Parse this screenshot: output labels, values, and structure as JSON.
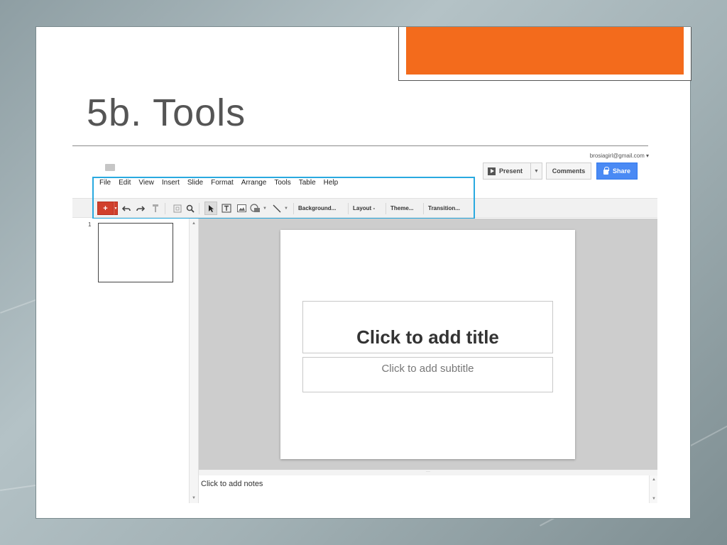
{
  "slide": {
    "title": "5b. Tools",
    "accent_color": "#f36b1c",
    "highlight_color": "#29a9e0"
  },
  "app": {
    "account": "brosiagirl@gmail.com ▾",
    "menu": [
      "File",
      "Edit",
      "View",
      "Insert",
      "Slide",
      "Format",
      "Arrange",
      "Tools",
      "Table",
      "Help"
    ],
    "buttons": {
      "present": "Present",
      "present_dropdown": "▼",
      "comments": "Comments",
      "share": "Share"
    },
    "toolbar": {
      "new": "+",
      "new_dropdown": "▼",
      "icons": [
        "undo-icon",
        "redo-icon",
        "paint-format-icon",
        "zoom-fit-icon",
        "zoom-icon",
        "select-icon",
        "textbox-icon",
        "image-icon",
        "shape-icon",
        "line-icon"
      ],
      "background": "Background...",
      "layout": "Layout -",
      "theme": "Theme...",
      "transition": "Transition..."
    },
    "filmstrip": {
      "slide_number": "1"
    },
    "canvas": {
      "title_placeholder": "Click to add title",
      "subtitle_placeholder": "Click to add subtitle",
      "divider_handle": "···"
    },
    "notes_placeholder": "Click to add notes"
  }
}
